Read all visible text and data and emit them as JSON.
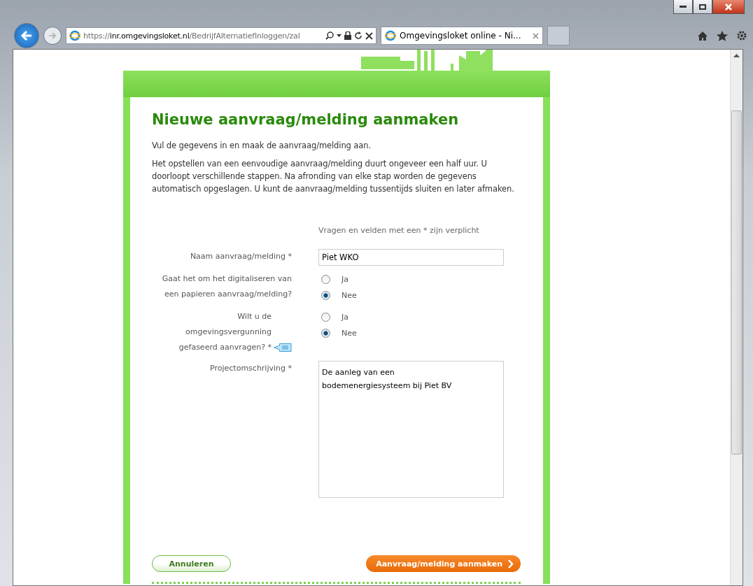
{
  "browser": {
    "url": "https://**inr.omgevingsloket.nl**/BedrijfAlternatiefInloggen/zal",
    "tabs": [
      {
        "label": "Omgevingsloket online - Ni...",
        "selected": true
      }
    ]
  },
  "page": {
    "title": "Nieuwe aanvraag/melding aanmaken",
    "intro": "Vul de gegevens in en maak de aanvraag/melding aan.",
    "description": "Het opstellen van een eenvoudige aanvraag/melding duurt ongeveer een half uur. U doorloopt verschillende stappen. Na afronding van elke stap worden de gegevens automatisch opgeslagen. U kunt de aanvraag/melding tussentijds sluiten en later afmaken.",
    "required_note": "Vragen en velden met een * zijn verplicht",
    "fields": [
      {
        "kind": "text",
        "label": "Naam aanvraag/melding *",
        "value": "Piet WKO"
      },
      {
        "kind": "radio",
        "label": "Gaat het om het digitaliseren van een papieren aanvraag/melding?",
        "help": false,
        "options": [
          {
            "label": "Ja",
            "selected": false
          },
          {
            "label": "Nee",
            "selected": true
          }
        ]
      },
      {
        "kind": "radio",
        "label": "Wilt u de omgevingsvergunning gefaseerd aanvragen? *",
        "help": true,
        "options": [
          {
            "label": "Ja",
            "selected": false
          },
          {
            "label": "Nee",
            "selected": true
          }
        ]
      },
      {
        "kind": "textarea",
        "label": "Projectomschrijving *",
        "value": "De aanleg van een\nbodemenergiesysteem bij Piet BV"
      }
    ],
    "cancel_button": "Annuleren",
    "submit_button": "Aanvraag/melding aanmaken"
  }
}
